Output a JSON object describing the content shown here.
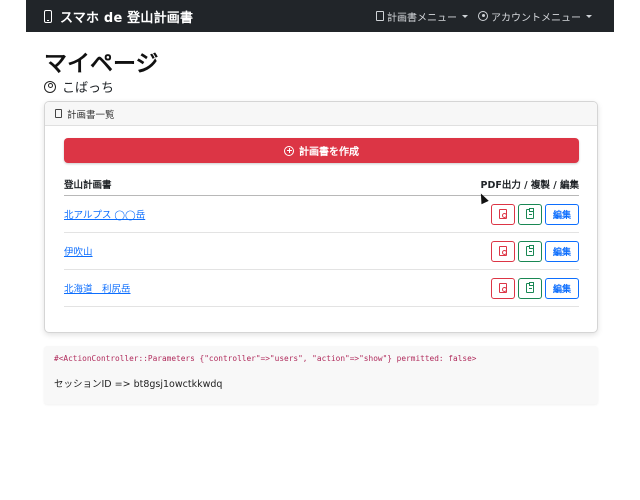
{
  "navbar": {
    "brand": "スマホ de 登山計画書",
    "plan_menu": "計画書メニュー",
    "account_menu": "アカウントメニュー"
  },
  "page": {
    "title": "マイページ",
    "user_name": "こばっち"
  },
  "card": {
    "header": "計画書一覧",
    "create_button": "計画書を作成",
    "columns": {
      "name": "登山計画書",
      "actions": "PDF出力 / 複製 / 編集"
    },
    "rows": [
      {
        "name": "北アルプス ◯◯岳",
        "edit": "編集"
      },
      {
        "name": "伊吹山",
        "edit": "編集"
      },
      {
        "name": "北海道　利尻岳",
        "edit": "編集"
      }
    ]
  },
  "debug": {
    "params": "#<ActionController::Parameters {\"controller\"=>\"users\", \"action\"=>\"show\"} permitted: false>",
    "session": "セッションID => bt8gsj1owctkkwdq"
  },
  "colors": {
    "navbar": "#212529",
    "danger": "#dc3545",
    "success": "#198754",
    "primary": "#0d6efd"
  }
}
